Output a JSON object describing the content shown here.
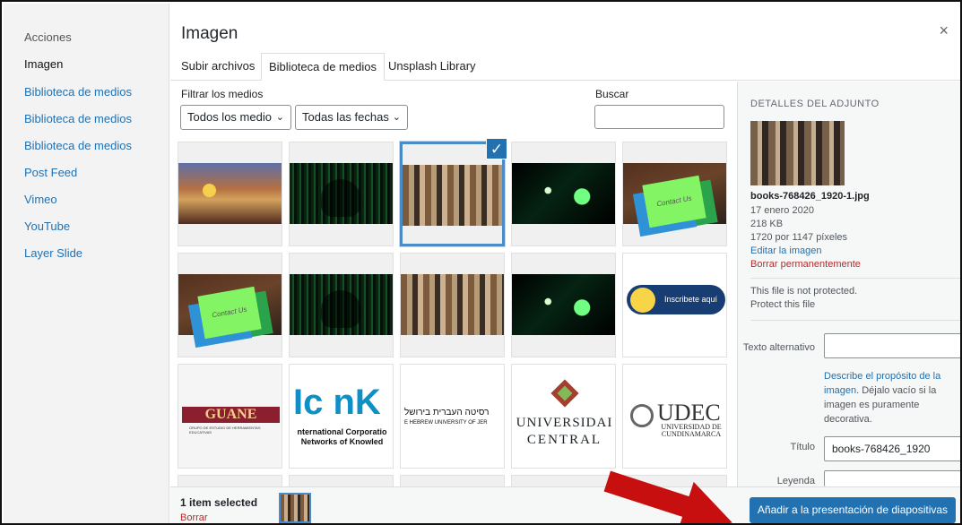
{
  "left_menu": {
    "actions": "Acciones",
    "current": "Imagen",
    "items": [
      "Biblioteca de medios",
      "Biblioteca de medios",
      "Biblioteca de medios",
      "Post Feed",
      "Vimeo",
      "YouTube",
      "Layer Slide"
    ]
  },
  "modal": {
    "title": "Imagen",
    "close_icon": "close-icon",
    "tabs": [
      "Subir archivos",
      "Biblioteca de medios",
      "Unsplash Library"
    ],
    "active_tab": "Biblioteca de medios"
  },
  "filters": {
    "label": "Filtrar los medios",
    "type": "Todos los medio",
    "dates": "Todas las fechas",
    "search_label": "Buscar",
    "search_value": ""
  },
  "media": {
    "selected_check": "✓",
    "tiles": [
      {
        "name": "media-audience",
        "kind": "audience",
        "selected": false
      },
      {
        "name": "media-matrix-hand",
        "kind": "matrix",
        "selected": false
      },
      {
        "name": "media-books-selected",
        "kind": "books",
        "selected": true
      },
      {
        "name": "media-network",
        "kind": "network",
        "selected": false
      },
      {
        "name": "media-contact-notes",
        "kind": "notes",
        "text": "Contact Us",
        "selected": false
      },
      {
        "name": "media-contact-notes-2",
        "kind": "notes",
        "text": "Contact Us",
        "selected": false
      },
      {
        "name": "media-matrix-hand-2",
        "kind": "matrix",
        "selected": false
      },
      {
        "name": "media-books-2",
        "kind": "books",
        "selected": false
      },
      {
        "name": "media-network-2",
        "kind": "network",
        "selected": false
      },
      {
        "name": "media-inscribete",
        "kind": "sign",
        "text": "Inscribete aquí",
        "selected": false
      },
      {
        "name": "media-guane",
        "kind": "guane",
        "text": "GUANE",
        "subtext": "GRUPO DE ESTUDIO DE HERRAMIENTAS EDUCATIVAS",
        "selected": false
      },
      {
        "name": "media-iconk",
        "kind": "iconk",
        "text": "Ic  nK",
        "subtext": "nternational Corporatio\nNetworks of Knowled",
        "selected": false
      },
      {
        "name": "media-hebrew",
        "kind": "hebrew",
        "text": "רסיטה העברית בירושל",
        "subtext": "E HEBREW UNIVERSITY OF JER",
        "selected": false
      },
      {
        "name": "media-universidad-central",
        "kind": "central",
        "text": "UNIVERSIDAI",
        "subtext": "CENTRAL",
        "selected": false
      },
      {
        "name": "media-udec",
        "kind": "udec",
        "text": "UDEC",
        "subtext": "UNIVERSIDAD DE\nCUNDINAMARCA",
        "selected": false
      }
    ]
  },
  "details": {
    "heading": "DETALLES DEL ADJUNTO",
    "filename": "books-768426_1920-1.jpg",
    "date": "17 enero 2020",
    "size": "218 KB",
    "dimensions": "1720 por 1147 píxeles",
    "edit": "Editar la imagen",
    "delete": "Borrar permanentemente",
    "protection": "This file is not protected.",
    "protect": "Protect this file",
    "alt_label": "Texto alternativo",
    "alt_value": "",
    "help_link": "Describe el propósito de la imagen",
    "help_text": ". Déjalo vacío si la imagen es puramente decorativa.",
    "title_label": "Título",
    "title_value": "books-768426_1920",
    "caption_label": "Leyenda",
    "caption_value": ""
  },
  "footer": {
    "selected": "1 item selected",
    "clear": "Borrar",
    "action": "Añadir a la presentación de diapositivas"
  }
}
